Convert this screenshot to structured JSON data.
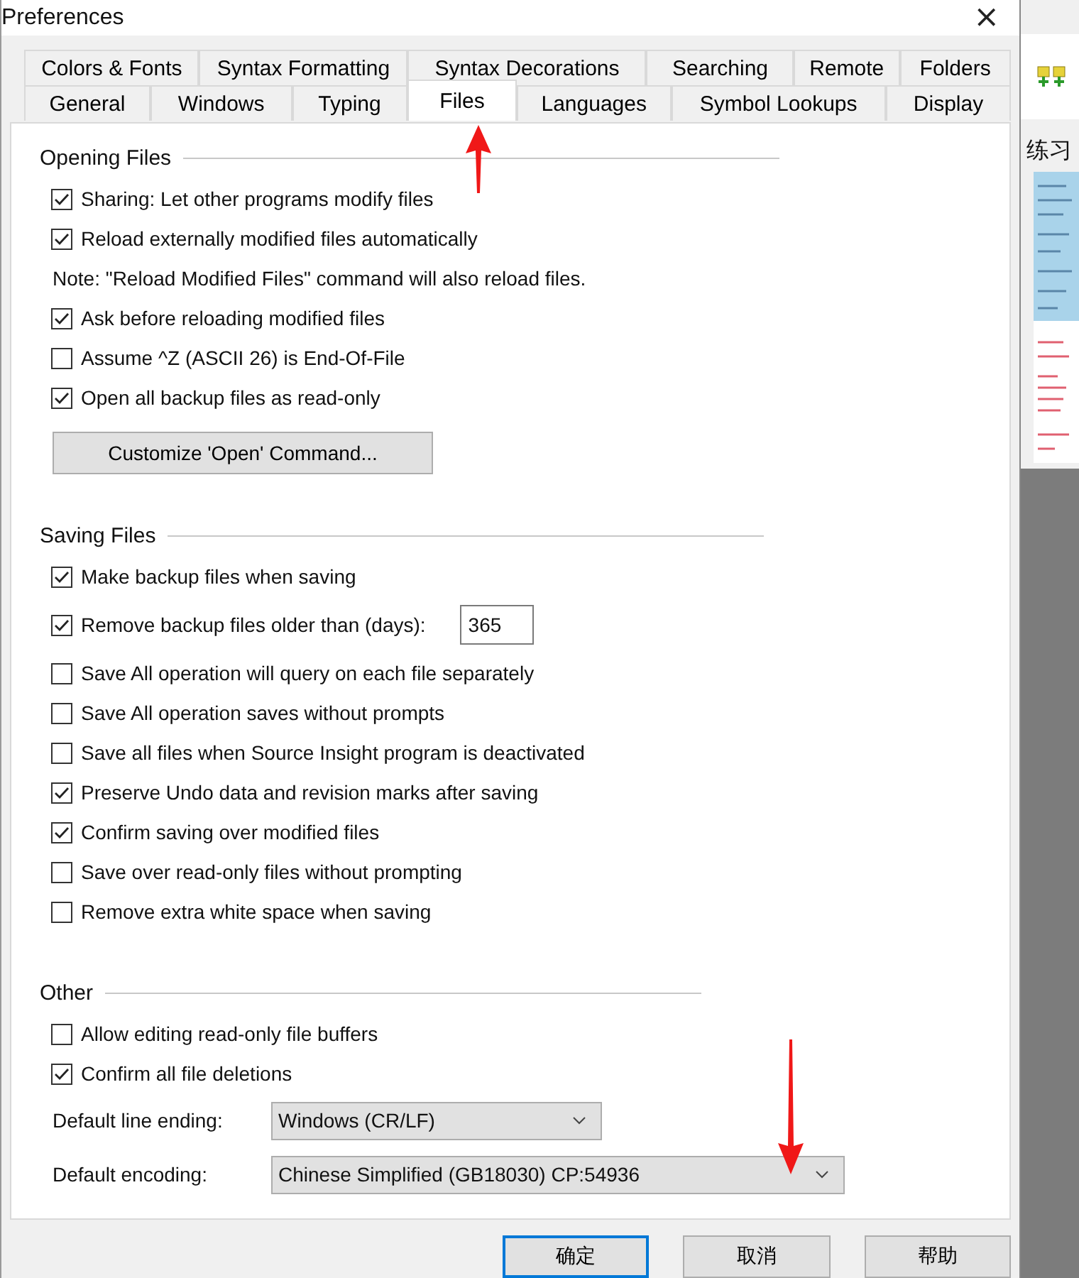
{
  "window": {
    "title": "Preferences",
    "close": "×"
  },
  "tabs": [
    [
      {
        "label": "Colors & Fonts",
        "selected": false
      },
      {
        "label": "Syntax Formatting",
        "selected": false
      },
      {
        "label": "Syntax Decorations",
        "selected": false
      },
      {
        "label": "Searching",
        "selected": false
      },
      {
        "label": "Remote",
        "selected": false
      },
      {
        "label": "Folders",
        "selected": false
      }
    ],
    [
      {
        "label": "General",
        "selected": false
      },
      {
        "label": "Windows",
        "selected": false
      },
      {
        "label": "Typing",
        "selected": false
      },
      {
        "label": "Files",
        "selected": true
      },
      {
        "label": "Languages",
        "selected": false
      },
      {
        "label": "Symbol Lookups",
        "selected": false
      },
      {
        "label": "Display",
        "selected": false
      }
    ]
  ],
  "sections": [
    {
      "title": "Opening Files",
      "items": [
        {
          "kind": "checkbox",
          "label": "Sharing: Let other programs modify files",
          "checked": true
        },
        {
          "kind": "checkbox",
          "label": "Reload externally modified files automatically",
          "checked": true
        },
        {
          "kind": "note",
          "text": "Note: \"Reload Modified Files\" command will also reload files."
        },
        {
          "kind": "checkbox",
          "label": "Ask before reloading modified files",
          "checked": true
        },
        {
          "kind": "checkbox",
          "label": "Assume ^Z (ASCII 26) is End-Of-File",
          "checked": false
        },
        {
          "kind": "checkbox",
          "label": "Open all backup files as read-only",
          "checked": true
        },
        {
          "kind": "button",
          "label": "Customize 'Open' Command..."
        }
      ]
    },
    {
      "title": "Saving Files",
      "items": [
        {
          "kind": "checkbox",
          "label": "Make backup files when saving",
          "checked": true
        },
        {
          "kind": "checkbox_field",
          "label": "Remove backup files older than (days):",
          "checked": true,
          "value": "365"
        },
        {
          "kind": "checkbox",
          "label": "Save All operation will query on each file separately",
          "checked": false
        },
        {
          "kind": "checkbox",
          "label": "Save All operation saves without prompts",
          "checked": false
        },
        {
          "kind": "checkbox",
          "label": "Save all files when Source Insight program is deactivated",
          "checked": false
        },
        {
          "kind": "checkbox",
          "label": "Preserve Undo data and revision marks after saving",
          "checked": true
        },
        {
          "kind": "checkbox",
          "label": "Confirm saving over modified files",
          "checked": true
        },
        {
          "kind": "checkbox",
          "label": "Save over read-only files without prompting",
          "checked": false
        },
        {
          "kind": "checkbox",
          "label": "Remove extra white space when saving",
          "checked": false
        }
      ]
    },
    {
      "title": "Other",
      "items": [
        {
          "kind": "checkbox",
          "label": "Allow editing read-only file buffers",
          "checked": false
        },
        {
          "kind": "checkbox",
          "label": "Confirm all file deletions",
          "checked": true
        },
        {
          "kind": "dropdown",
          "label": "Default line ending:",
          "value": "Windows (CR/LF)"
        },
        {
          "kind": "dropdown",
          "label": "Default encoding:",
          "value": "Chinese Simplified (GB18030)  CP:54936"
        }
      ]
    }
  ],
  "buttons": [
    {
      "label": "确定",
      "selected": true
    },
    {
      "label": "取消",
      "selected": false
    },
    {
      "label": "帮助",
      "selected": false
    }
  ],
  "background_window": {
    "title": "练习"
  }
}
